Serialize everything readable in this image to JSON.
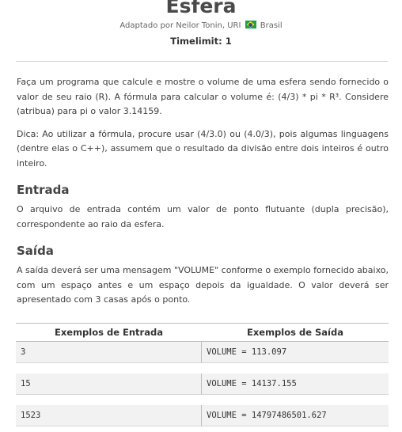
{
  "header": {
    "title": "Esfera",
    "credit_prefix": "Adaptado por Neilor Tonin, URI",
    "credit_country": "Brasil",
    "flag_icon": "brazil-flag-icon",
    "timelimit": "Timelimit: 1"
  },
  "body": {
    "description": "Faça um programa que calcule e mostre o volume de uma esfera sendo fornecido o valor de seu raio (R). A fórmula para calcular o volume é: (4/3) * pi * R³. Considere (atribua) para pi o valor 3.14159.",
    "tip": "Dica: Ao utilizar a fórmula, procure usar (4/3.0) ou (4.0/3), pois algumas linguagens (dentre elas o C++), assumem que o resultado da divisão entre dois inteiros é outro inteiro.",
    "input_heading": "Entrada",
    "input_text": "O arquivo de entrada contém um valor de ponto flutuante (dupla precisão), correspondente ao raio da esfera.",
    "output_heading": "Saída",
    "output_text": "A saída deverá ser uma mensagem \"VOLUME\" conforme o exemplo fornecido abaixo, com um espaço antes e um espaço depois da igualdade. O valor deverá ser apresentado com 3 casas após o ponto."
  },
  "examples": {
    "input_header": "Exemplos de Entrada",
    "output_header": "Exemplos de Saída",
    "rows": [
      {
        "input": "3",
        "output": "VOLUME = 113.097"
      },
      {
        "input": "15",
        "output": "VOLUME = 14137.155"
      },
      {
        "input": "1523",
        "output": "VOLUME = 14797486501.627"
      }
    ]
  }
}
